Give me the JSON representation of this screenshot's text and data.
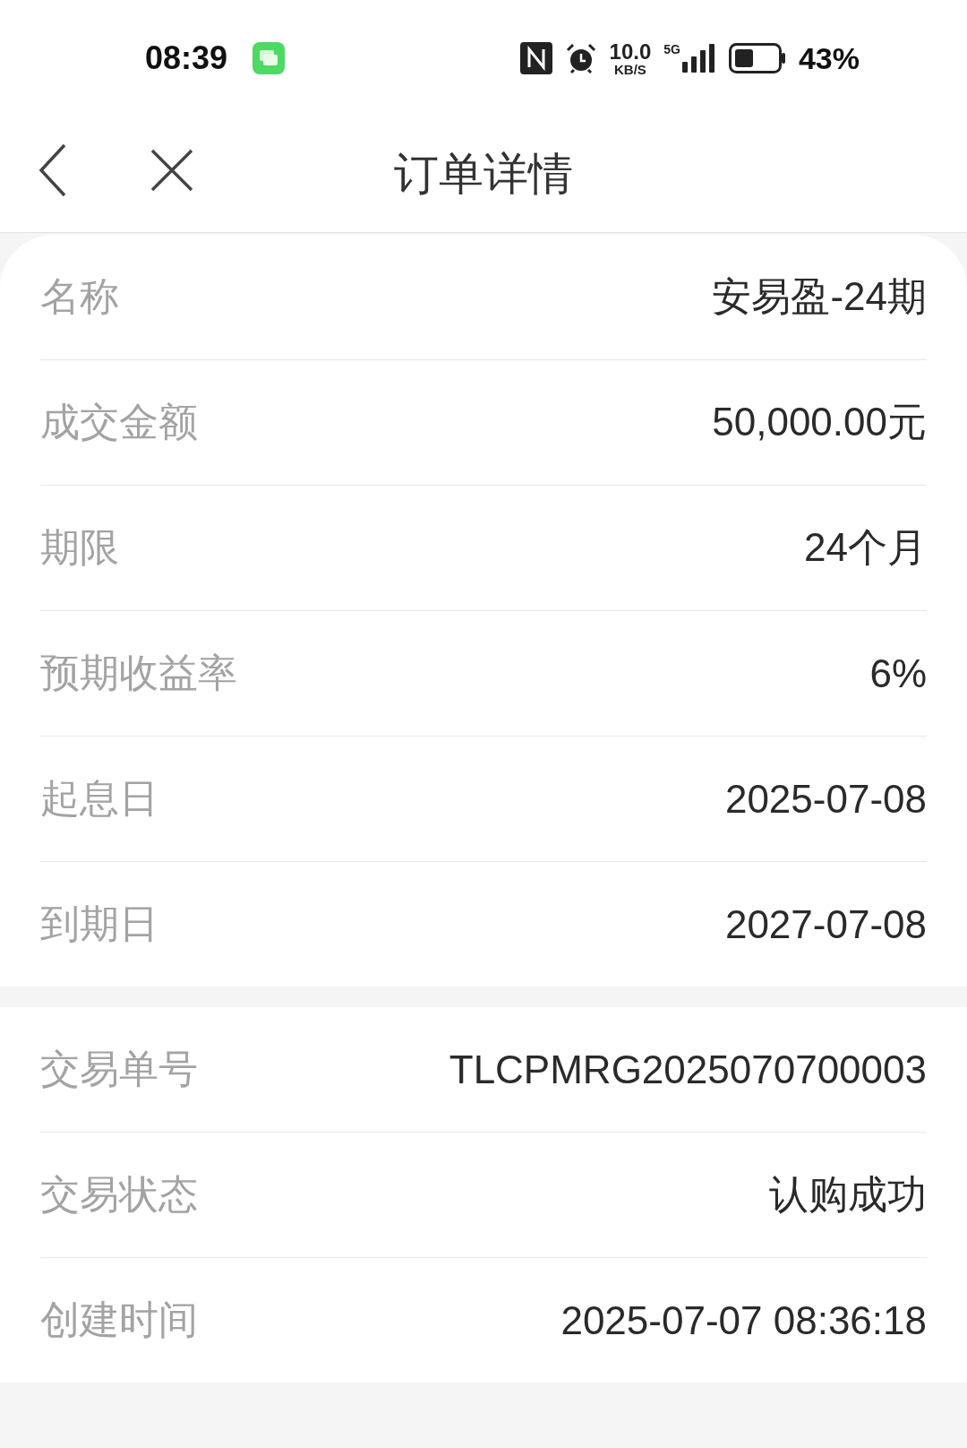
{
  "status_bar": {
    "time": "08:39",
    "net_speed": "10.0",
    "net_unit": "KB/S",
    "network": "5G",
    "battery": "43%"
  },
  "nav": {
    "title": "订单详情"
  },
  "sections": [
    {
      "rows": [
        {
          "label": "名称",
          "value": "安易盈-24期"
        },
        {
          "label": "成交金额",
          "value": "50,000.00元"
        },
        {
          "label": "期限",
          "value": "24个月"
        },
        {
          "label": "预期收益率",
          "value": "6%"
        },
        {
          "label": "起息日",
          "value": "2025-07-08"
        },
        {
          "label": "到期日",
          "value": "2027-07-08"
        }
      ]
    },
    {
      "rows": [
        {
          "label": "交易单号",
          "value": "TLCPMRG2025070700003"
        },
        {
          "label": "交易状态",
          "value": "认购成功"
        },
        {
          "label": "创建时间",
          "value": "2025-07-07 08:36:18"
        }
      ]
    }
  ]
}
